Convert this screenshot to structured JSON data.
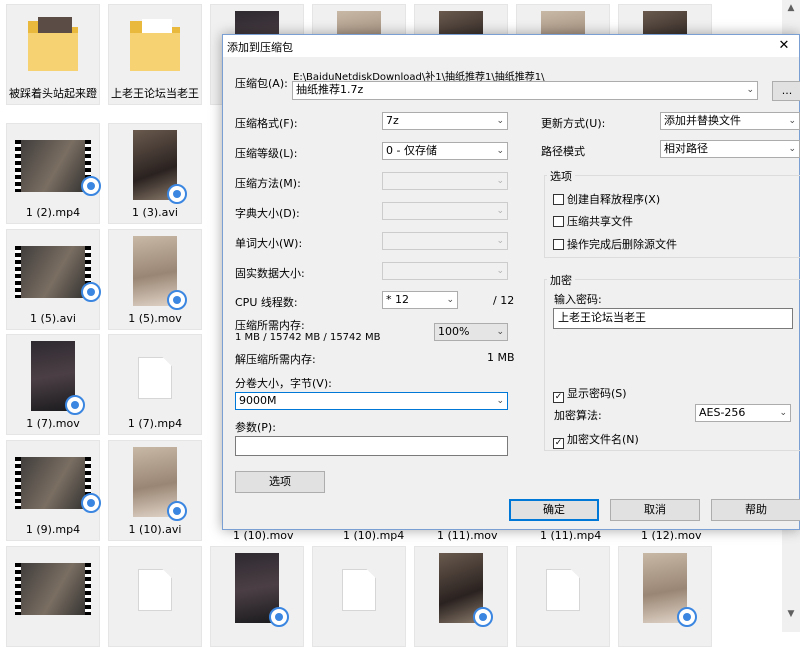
{
  "explorer": {
    "tiles": [
      {
        "label": "被踩着头站起来蹬"
      },
      {
        "label": "上老王论坛当老王"
      },
      {
        "label": ""
      },
      {
        "label": ""
      },
      {
        "label": ""
      },
      {
        "label": ""
      },
      {
        "label": ""
      },
      {
        "label": "1 (2).mp4"
      },
      {
        "label": "1 (3).avi"
      },
      {
        "label": "1 (5).avi"
      },
      {
        "label": "1 (5).mov"
      },
      {
        "label": "1 (7).mov"
      },
      {
        "label": "1 (7).mp4"
      },
      {
        "label": "1 (9).mp4"
      },
      {
        "label": "1 (10).avi"
      },
      {
        "label": "1 (10).mov"
      },
      {
        "label": "1 (10).mp4"
      },
      {
        "label": "1 (11).mov"
      },
      {
        "label": "1 (11).mp4"
      },
      {
        "label": "1 (12).mov"
      }
    ]
  },
  "dialog": {
    "title": "添加到压缩包",
    "archive_label": "压缩包(A):",
    "archive_path": "E:\\BaiduNetdiskDownload\\补1\\抽纸推荐1\\抽纸推荐1\\",
    "archive_name": "抽纸推荐1.7z",
    "browse_label": "...",
    "format_label": "压缩格式(F):",
    "format_value": "7z",
    "level_label": "压缩等级(L):",
    "level_value": "0 - 仅存储",
    "method_label": "压缩方法(M):",
    "dict_label": "字典大小(D):",
    "word_label": "单词大小(W):",
    "solid_label": "固实数据大小:",
    "cpu_label": "CPU 线程数:",
    "cpu_value": "* 12",
    "cpu_total": "/ 12",
    "mem_compress_label": "压缩所需内存:",
    "mem_compress_value": "1 MB / 15742 MB / 15742 MB",
    "mem_percent": "100%",
    "mem_decompress_label": "解压缩所需内存:",
    "mem_decompress_value": "1 MB",
    "volume_label": "分卷大小，字节(V):",
    "volume_value": "9000M",
    "params_label": "参数(P):",
    "params_value": "",
    "options_button": "选项",
    "update_label": "更新方式(U):",
    "update_value": "添加并替换文件",
    "path_label": "路径模式",
    "path_value": "相对路径",
    "options_group": "选项",
    "opt_sfx": "创建自释放程序(X)",
    "opt_shared": "压缩共享文件",
    "opt_delete": "操作完成后删除源文件",
    "encrypt_group": "加密",
    "password_label": "输入密码:",
    "password_value": "上老王论坛当老王",
    "show_password": "显示密码(S)",
    "enc_method_label": "加密算法:",
    "enc_method_value": "AES-256",
    "enc_names": "加密文件名(N)",
    "ok": "确定",
    "cancel": "取消",
    "help": "帮助"
  },
  "checks": {
    "sfx": false,
    "shared": false,
    "delete": false,
    "show_password": true,
    "enc_names": true
  }
}
